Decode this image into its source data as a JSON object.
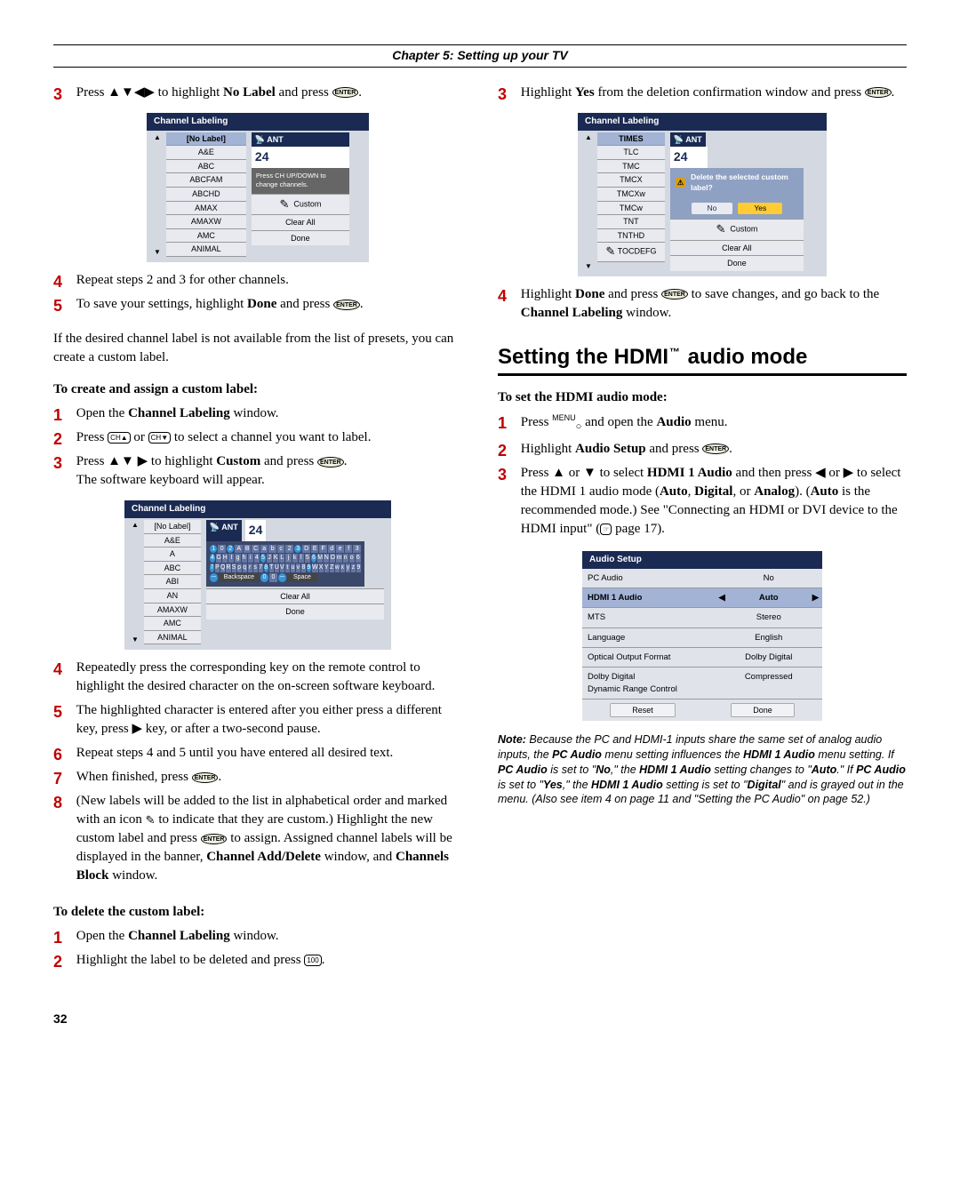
{
  "chapter_title": "Chapter 5: Setting up your TV",
  "page_number": "32",
  "left": {
    "step3": "Press ▲▼◀▶ to highlight ",
    "step3_bold": "No Label",
    "step3_after": " and press ",
    "screenshot1": {
      "title": "Channel Labeling",
      "items": [
        "[No Label]",
        "A&E",
        "ABC",
        "ABCFAM",
        "ABCHD",
        "AMAX",
        "AMAXW",
        "AMC",
        "ANIMAL"
      ],
      "ant_label": "ANT",
      "channel": "24",
      "msg": "Press CH UP/DOWN to change channels.",
      "buttons": [
        "Custom",
        "Clear All",
        "Done"
      ]
    },
    "step4": "Repeat steps 2 and 3 for other channels.",
    "step5_a": "To save your settings, highlight ",
    "step5_bold": "Done",
    "step5_b": " and press ",
    "para1": "If the desired channel label is not available from the list of presets, you can create a custom label.",
    "subhead1": "To create and assign a custom label:",
    "sub1_1a": "Open the ",
    "sub1_1b": "Channel Labeling",
    "sub1_1c": " window.",
    "sub1_2": "Press ",
    "sub1_2b": " or ",
    "sub1_2c": " to select a channel you want to label.",
    "sub1_3a": "Press ▲▼ ▶ to highlight ",
    "sub1_3b": "Custom",
    "sub1_3c": " and press ",
    "sub1_3d": "The software keyboard will appear.",
    "screenshot2": {
      "title": "Channel Labeling",
      "items": [
        "[No Label]",
        "A&E",
        "A",
        "ABC",
        "ABI",
        "AN",
        "AMAXW",
        "AMC",
        "ANIMAL"
      ],
      "ant_label": "ANT",
      "channel": "24",
      "buttons": [
        "Clear All",
        "Done"
      ]
    },
    "sub1_4": "Repeatedly press the corresponding key on the remote control to highlight the desired character on the on-screen software keyboard.",
    "sub1_5": "The highlighted character is entered after you either press a different key, press ▶ key, or after a two-second pause.",
    "sub1_6": "Repeat steps 4 and 5 until you have entered all desired text.",
    "sub1_7": "When finished, press ",
    "sub1_8a": "(New labels will be added to the list in alphabetical order and marked with an icon ",
    "sub1_8b": " to indicate that they are custom.) Highlight the new custom label and press ",
    "sub1_8c": " to assign. Assigned channel labels will be displayed in the banner, ",
    "sub1_8d": "Channel Add/Delete",
    "sub1_8e": " window, and ",
    "sub1_8f": "Channels Block",
    "sub1_8g": " window.",
    "subhead2": "To delete the custom label:",
    "del_1a": "Open the ",
    "del_1b": "Channel Labeling",
    "del_1c": " window.",
    "del_2": "Highlight the label to be deleted and press "
  },
  "right": {
    "step3a": "Highlight ",
    "step3b": "Yes",
    "step3c": " from the deletion confirmation window and press ",
    "screenshot3": {
      "title": "Channel Labeling",
      "items": [
        "TIMES",
        "TLC",
        "TMC",
        "TMCX",
        "TMCXw",
        "TMCw",
        "TNT",
        "TNTHD",
        "TOCDEFG"
      ],
      "ant_label": "ANT",
      "channel": "24",
      "alert": "Delete the selected custom label?",
      "no": "No",
      "yes": "Yes",
      "buttons": [
        "Custom",
        "Clear All",
        "Done"
      ]
    },
    "step4a": "Highlight ",
    "step4b": "Done",
    "step4c": " and press ",
    "step4d": " to save changes, and go back to the ",
    "step4e": "Channel Labeling",
    "step4f": " window.",
    "heading": "Setting the HDMI",
    "heading_after": " audio mode",
    "subhead": "To set the HDMI audio mode:",
    "a1": "Press ",
    "a1b": " and open the ",
    "a1c": "Audio",
    "a1d": " menu.",
    "a2a": "Highlight ",
    "a2b": "Audio Setup",
    "a2c": " and press ",
    "a3a": "Press ▲ or ▼ to select ",
    "a3b": "HDMI 1 Audio",
    "a3c": " and then press ◀ or ▶ to select the HDMI 1 audio mode (",
    "a3d": "Auto",
    "a3e": ", ",
    "a3f": "Digital",
    "a3g": ", or ",
    "a3h": "Analog",
    "a3i": "). (",
    "a3j": "Auto",
    "a3k": " is the recommended mode.) See \"Connecting an HDMI or DVI device to the HDMI input\" (",
    "a3l": " page 17).",
    "audio_setup": {
      "title": "Audio Setup",
      "rows": [
        {
          "label": "PC Audio",
          "val": "No"
        },
        {
          "label": "HDMI 1 Audio",
          "val": "Auto",
          "sel": true
        },
        {
          "label": "MTS",
          "val": "Stereo"
        },
        {
          "label": "Language",
          "val": "English"
        },
        {
          "label": "Optical Output Format",
          "val": "Dolby Digital"
        },
        {
          "label": "Dolby Digital\nDynamic Range Control",
          "val": "Compressed"
        }
      ],
      "reset": "Reset",
      "done": "Done"
    },
    "note_label": "Note:",
    "note_body_a": " Because the PC and HDMI-1 inputs share the same set of analog audio inputs, the ",
    "note_b1": "PC Audio",
    "note_body_b": " menu setting influences the ",
    "note_b2": "HDMI 1 Audio",
    "note_body_c": " menu setting. If ",
    "note_b3": "PC Audio",
    "note_body_d": " is set to \"",
    "note_b4": "No",
    "note_body_e": ",\" the ",
    "note_b5": "HDMI 1 Audio",
    "note_body_f": " setting changes to \"",
    "note_b6": "Auto",
    "note_body_g": ".\" If ",
    "note_b7": "PC Audio",
    "note_body_h": " is set to \"",
    "note_b8": "Yes",
    "note_body_i": ",\" the ",
    "note_b9": "HDMI 1 Audio",
    "note_body_j": " setting is set to \"",
    "note_b10": "Digital",
    "note_body_k": "\" and is grayed out in the menu. (Also see item 4 on page 11 and \"Setting the PC Audio\" on page 52.)"
  }
}
